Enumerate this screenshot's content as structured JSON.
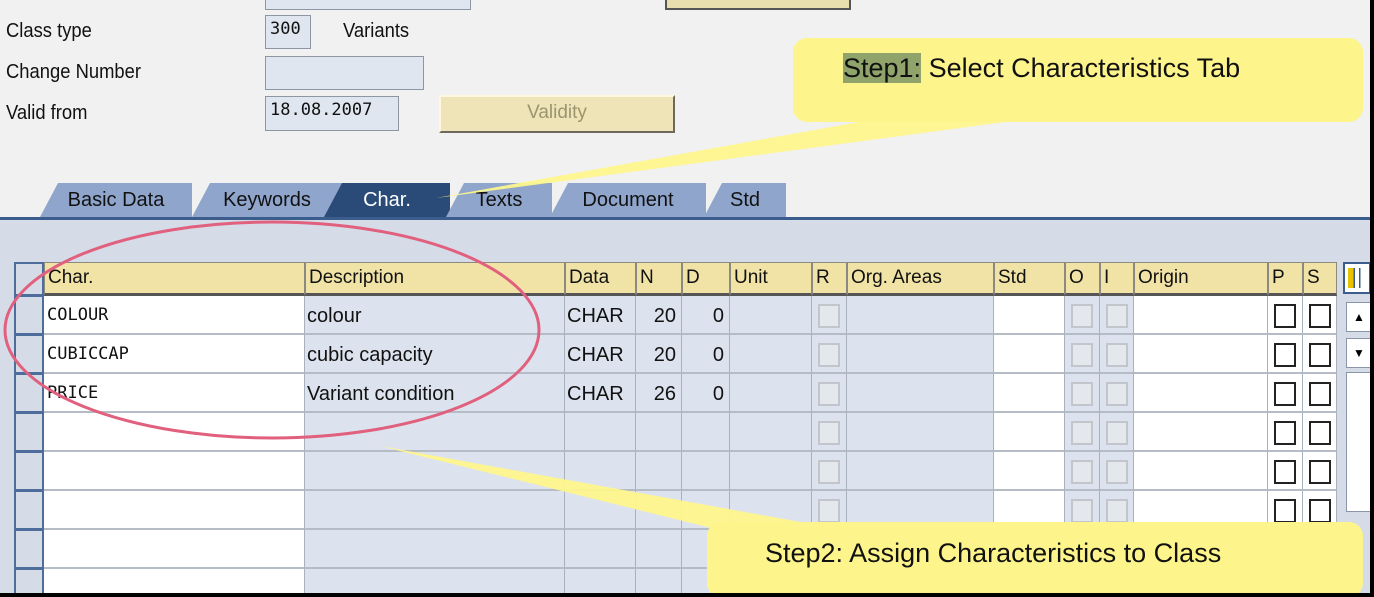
{
  "header_fields": {
    "class_type_label": "Class type",
    "class_type_value": "300",
    "class_type_text": "Variants",
    "change_number_label": "Change Number",
    "change_number_value": "",
    "valid_from_label": "Valid from",
    "valid_from_value": "18.08.2007",
    "validity_button": "Validity"
  },
  "tabs": [
    {
      "label": "Basic Data"
    },
    {
      "label": "Keywords"
    },
    {
      "label": "Char.",
      "active": true
    },
    {
      "label": "Texts"
    },
    {
      "label": "Document"
    },
    {
      "label": "Std"
    }
  ],
  "table": {
    "columns": [
      "Char.",
      "Description",
      "Data",
      "N",
      "D",
      "Unit",
      "R",
      "Org. Areas",
      "Std",
      "O",
      "I",
      "Origin",
      "P",
      "S"
    ],
    "rows": [
      {
        "char": "COLOUR",
        "description": "colour",
        "data": "CHAR",
        "n": "20",
        "d": "0"
      },
      {
        "char": "CUBICCAP",
        "description": "cubic capacity",
        "data": "CHAR",
        "n": "20",
        "d": "0"
      },
      {
        "char": "PRICE",
        "description": "Variant condition",
        "data": "CHAR",
        "n": "26",
        "d": "0"
      },
      {},
      {},
      {},
      {},
      {}
    ]
  },
  "callouts": {
    "step1_prefix": "Step1:",
    "step1_text": " Select Characteristics Tab",
    "step2": "Step2: Assign Characteristics to Class"
  },
  "colors": {
    "tab_active": "#2a4a78",
    "tab": "#8fa5cc",
    "header": "#f1e3a6",
    "callout": "#fdf58c",
    "highlight_ellipse": "#e0607e"
  }
}
